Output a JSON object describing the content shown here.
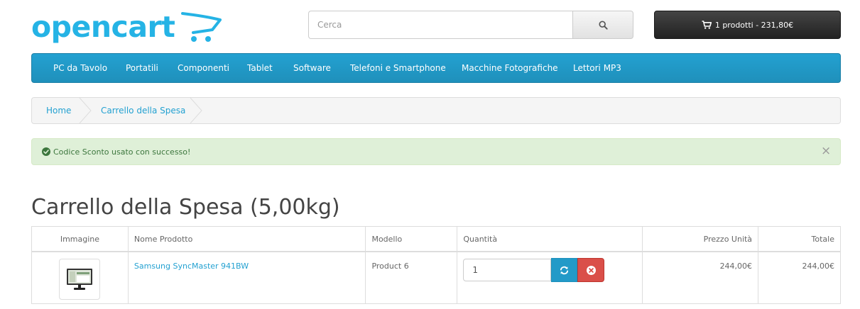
{
  "header": {
    "logo_text": "opencart",
    "search": {
      "placeholder": "Cerca",
      "value": ""
    },
    "cart_button_label": "1 prodotti - 231,80€"
  },
  "menu": {
    "items": [
      {
        "label": "PC da Tavolo"
      },
      {
        "label": "Portatili"
      },
      {
        "label": "Componenti"
      },
      {
        "label": "Tablet"
      },
      {
        "label": "Software"
      },
      {
        "label": "Telefoni e Smartphone"
      },
      {
        "label": "Macchine Fotografiche"
      },
      {
        "label": "Lettori MP3"
      }
    ]
  },
  "breadcrumb": [
    {
      "label": "Home"
    },
    {
      "label": "Carrello della Spesa"
    }
  ],
  "alert": {
    "text": "Codice Sconto usato con successo!",
    "close": "×",
    "color": "#3c763d"
  },
  "page": {
    "title": "Carrello della Spesa  (5,00kg)"
  },
  "cart_table": {
    "headers": {
      "image": "Immagine",
      "name": "Nome Prodotto",
      "model": "Modello",
      "quantity": "Quantità",
      "unit_price": "Prezzo Unità",
      "total": "Totale"
    },
    "rows": [
      {
        "name": "Samsung SyncMaster 941BW",
        "model": "Product 6",
        "quantity": "1",
        "unit_price": "244,00€",
        "total": "244,00€"
      }
    ]
  },
  "colors": {
    "accent": "#23a1d1",
    "danger": "#da4f49",
    "success_bg": "#dff0d8"
  },
  "icons": {
    "search": "search-icon",
    "cart": "shopping-cart-icon",
    "alert": "check-circle-icon",
    "refresh": "refresh-icon",
    "remove": "times-circle-icon"
  }
}
